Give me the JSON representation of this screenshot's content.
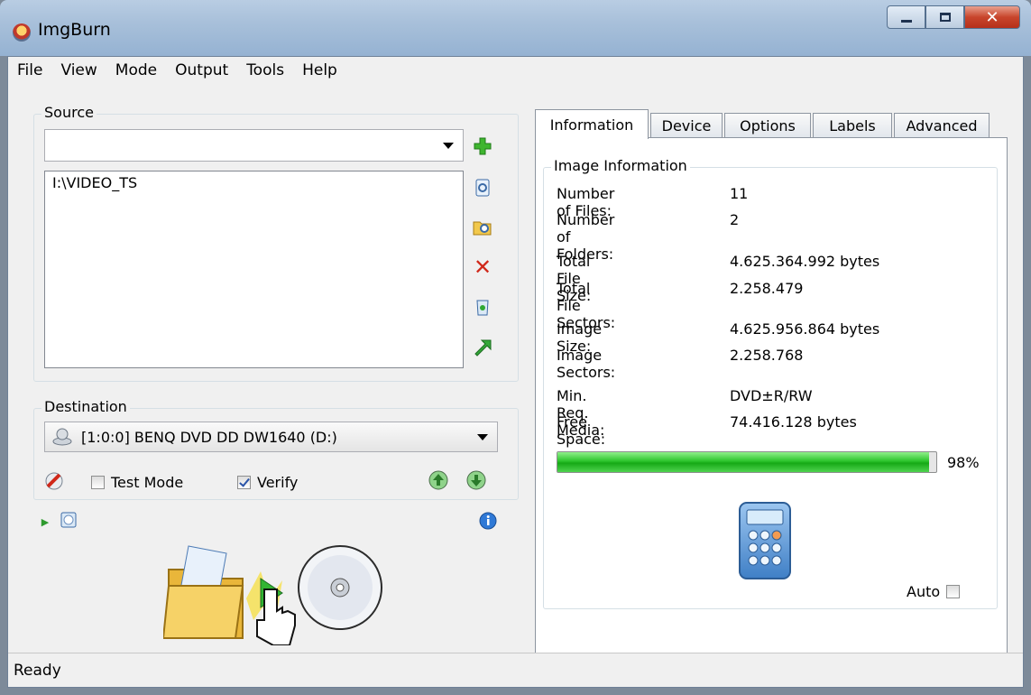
{
  "window": {
    "title": "ImgBurn"
  },
  "menu": [
    "File",
    "View",
    "Mode",
    "Output",
    "Tools",
    "Help"
  ],
  "source": {
    "label": "Source",
    "combo_value": "",
    "items": [
      "I:\\VIDEO_TS"
    ]
  },
  "destination": {
    "label": "Destination",
    "drive": "[1:0:0] BENQ DVD DD DW1640 (D:)",
    "test_mode_label": "Test Mode",
    "test_mode_checked": false,
    "verify_label": "Verify",
    "verify_checked": true
  },
  "tabs": [
    "Information",
    "Device",
    "Options",
    "Labels",
    "Advanced"
  ],
  "active_tab": "Information",
  "info": {
    "group_label": "Image Information",
    "rows": [
      {
        "label": "Number of Files:",
        "value": "11"
      },
      {
        "label": "Number of Folders:",
        "value": "2"
      },
      {
        "label": "Total File Size:",
        "value": "4.625.364.992 bytes"
      },
      {
        "label": "Total File Sectors:",
        "value": "2.258.479"
      },
      {
        "label": "Image Size:",
        "value": "4.625.956.864 bytes"
      },
      {
        "label": "Image Sectors:",
        "value": "2.258.768"
      },
      {
        "label": "Min. Req. Media:",
        "value": "DVD±R/RW"
      },
      {
        "label": "Free Space:",
        "value": "74.416.128 bytes"
      }
    ],
    "progress_percent": 98,
    "progress_text": "98%",
    "auto_label": "Auto",
    "auto_checked": false
  },
  "status": {
    "text": "Ready"
  },
  "colors": {
    "progress_green": "#1db81d",
    "close_red": "#c8452c"
  }
}
